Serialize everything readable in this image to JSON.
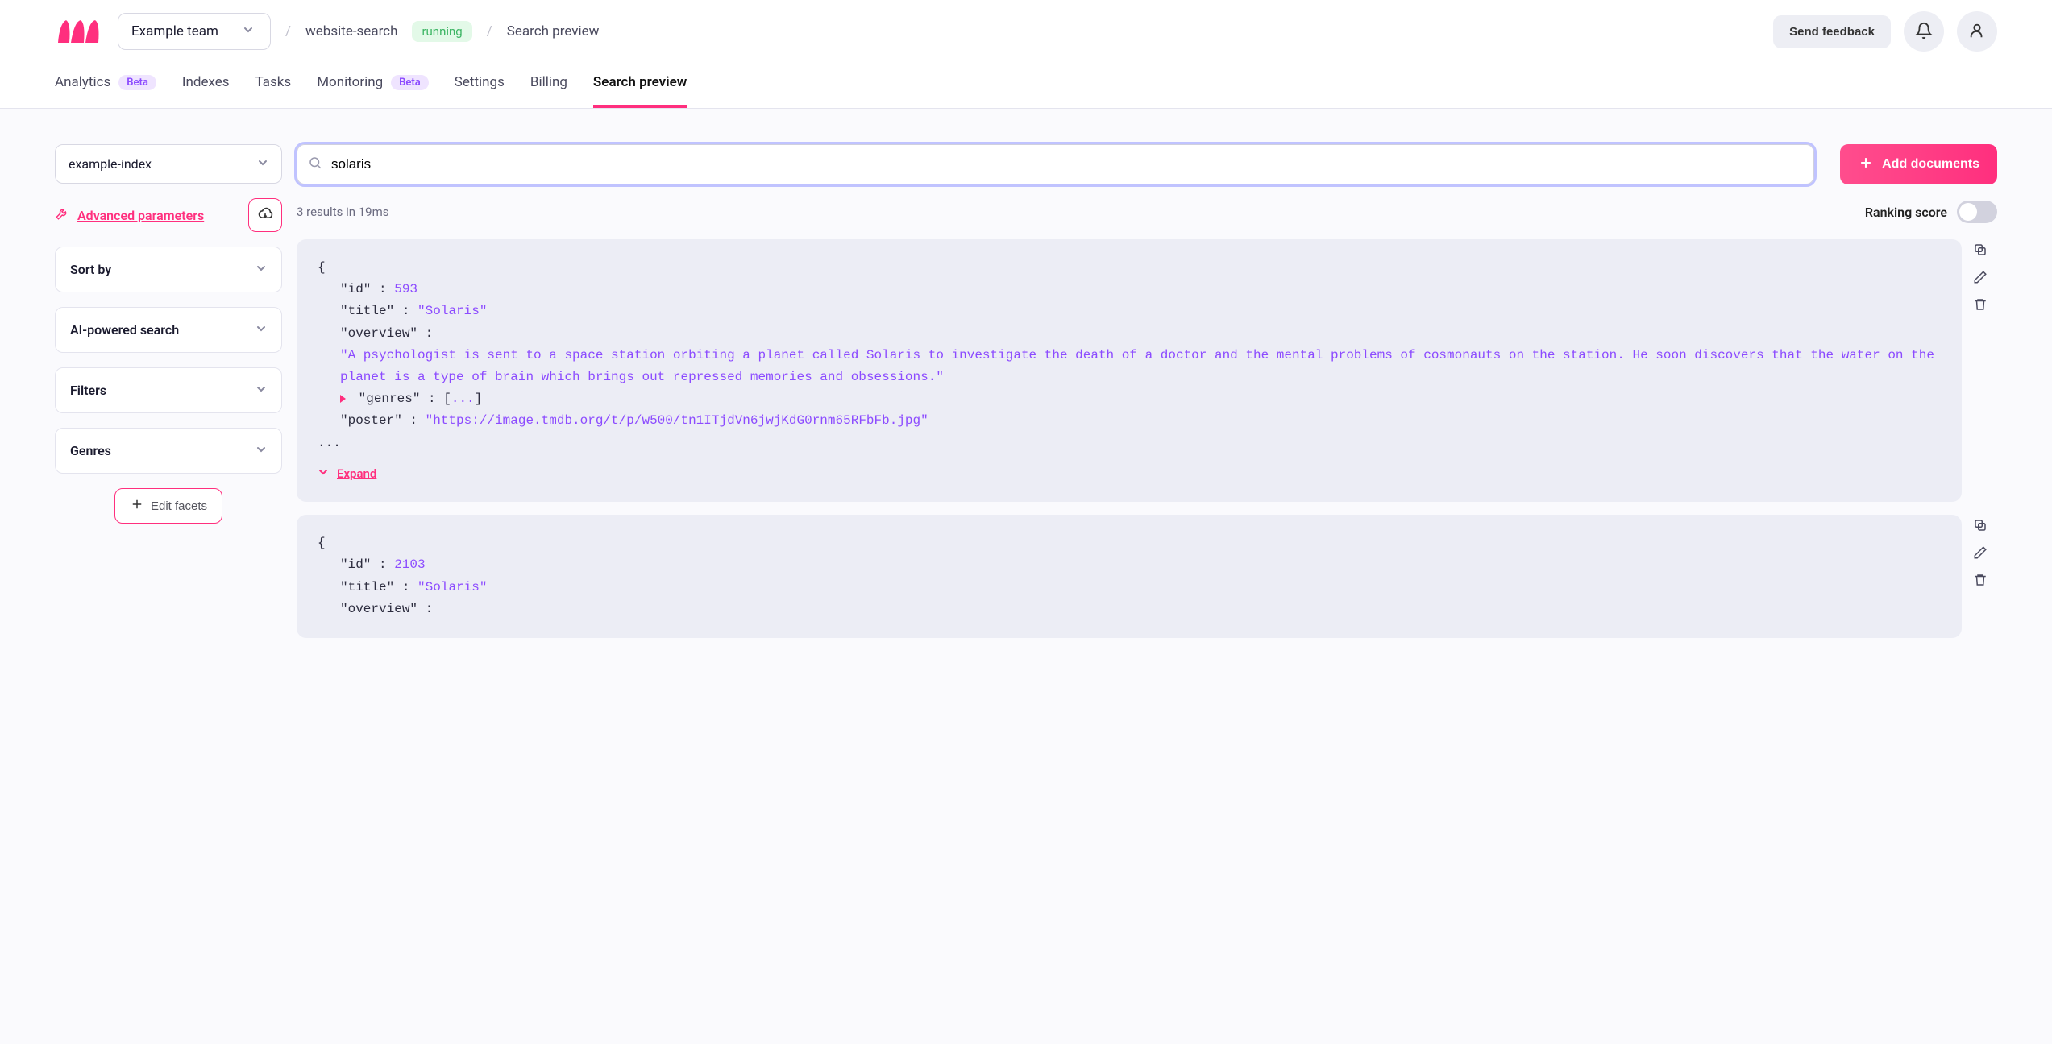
{
  "header": {
    "team": "Example team",
    "breadcrumb_project": "website-search",
    "status": "running",
    "breadcrumb_page": "Search preview",
    "feedback": "Send feedback"
  },
  "tabs": [
    {
      "label": "Analytics",
      "beta": true
    },
    {
      "label": "Indexes",
      "beta": false
    },
    {
      "label": "Tasks",
      "beta": false
    },
    {
      "label": "Monitoring",
      "beta": true
    },
    {
      "label": "Settings",
      "beta": false
    },
    {
      "label": "Billing",
      "beta": false
    },
    {
      "label": "Search preview",
      "beta": false
    }
  ],
  "beta_label": "Beta",
  "sidebar": {
    "index": "example-index",
    "advanced": "Advanced parameters",
    "panels": [
      "Sort by",
      "AI-powered search",
      "Filters",
      "Genres"
    ],
    "edit_facets": "Edit facets"
  },
  "search": {
    "query": "solaris",
    "add_documents": "Add documents"
  },
  "meta": {
    "results_text": "3 results in 19ms",
    "ranking_label": "Ranking score"
  },
  "results": [
    {
      "id": 593,
      "title": "\"Solaris\"",
      "overview": "\"A psychologist is sent to a space station orbiting a planet called Solaris to investigate the death of a doctor and the mental problems of cosmonauts on the station. He soon discovers that the water on the planet is a type of brain which brings out repressed memories and obsessions.\"",
      "genres_collapsed": "[...]",
      "poster": "\"https://image.tmdb.org/t/p/w500/tn1ITjdVn6jwjKdG0rnm65RFbFb.jpg\"",
      "ellipsis": "...",
      "expand": "Expand"
    },
    {
      "id": 2103,
      "title": "\"Solaris\"",
      "overview_key": "\"overview\" :"
    }
  ],
  "json_keys": {
    "id": "\"id\"",
    "title": "\"title\"",
    "overview": "\"overview\"",
    "genres": "\"genres\"",
    "poster": "\"poster\""
  }
}
